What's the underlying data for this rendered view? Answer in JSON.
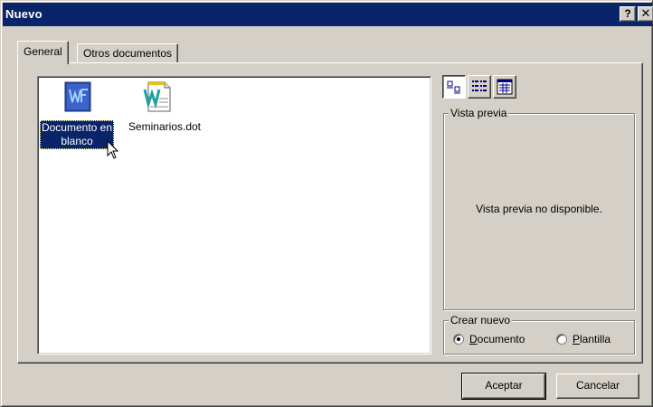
{
  "window": {
    "title": "Nuevo",
    "help_glyph": "?",
    "close_glyph": "✕"
  },
  "tabs": [
    {
      "label": "General",
      "active": true
    },
    {
      "label": "Otros documentos",
      "active": false
    }
  ],
  "files": [
    {
      "label": "Documento en blanco",
      "icon": "word-blank-document-icon",
      "selected": true
    },
    {
      "label": "Seminarios.dot",
      "icon": "word-template-icon",
      "selected": false
    }
  ],
  "view_buttons": [
    {
      "name": "large-icons-view",
      "active": true
    },
    {
      "name": "list-view",
      "active": false
    },
    {
      "name": "details-view",
      "active": false
    }
  ],
  "preview": {
    "legend": "Vista previa",
    "message": "Vista previa no disponible."
  },
  "create_new": {
    "legend": "Crear nuevo",
    "options": [
      {
        "label": "Documento",
        "accel": "D",
        "rest": "ocumento",
        "selected": true
      },
      {
        "label": "Plantilla",
        "accel": "P",
        "rest": "lantilla",
        "selected": false
      }
    ]
  },
  "buttons": {
    "ok": "Aceptar",
    "cancel": "Cancelar"
  },
  "colors": {
    "title_bar": "#0a246a",
    "face": "#d4d0c8",
    "selection": "#0a246a"
  }
}
